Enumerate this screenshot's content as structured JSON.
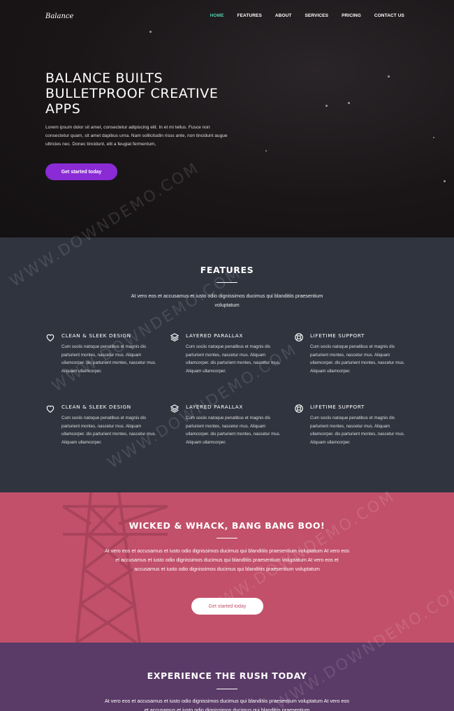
{
  "brand": "Balance",
  "nav": [
    {
      "label": "HOME",
      "active": true
    },
    {
      "label": "FEATURES"
    },
    {
      "label": "ABOUT"
    },
    {
      "label": "SERVICES"
    },
    {
      "label": "PRICING"
    },
    {
      "label": "CONTACT US"
    }
  ],
  "hero": {
    "title": "BALANCE BUILTS BULLETPROOF CREATIVE APPS",
    "text": "Lorem ipsum dolor sit amet, consectetur adipiscing elit. In et mi tellus. Fusce non consectetur quam, sit amet dapibus urna. Nam sollicitudin risus ante, non tincidunt augue ultricies nec. Donec tincidunt, elit a feugiat fermentum,",
    "button": "Get started today"
  },
  "features": {
    "title": "FEATURES",
    "subtitle": "At vero eos et accusamus et iusto odio dignissimos ducimus qui blanditiis praesentium voluptatum",
    "items": [
      {
        "icon": "heart-icon",
        "title": "CLEAN & SLEEK DESIGN",
        "text": "Cum sociis natoque penatibus et magnis dis parturient montes, nascetur mus. Aliquam ullamcorper. dis parturient montes, nascetur mus. Aliquam ullamcorper."
      },
      {
        "icon": "layers-icon",
        "title": "LAYERED PARALLAX",
        "text": "Cum sociis natoque penatibus et magnis dis parturient montes, nascetur mus. Aliquam ullamcorper. dis parturient montes, nascetur mus. Aliquam ullamcorper."
      },
      {
        "icon": "lifebuoy-icon",
        "title": "LIFETIME SUPPORT",
        "text": "Cum sociis natoque penatibus et magnis dis parturient montes, nascetur mus. Aliquam ullamcorper. dis parturient montes, nascetur mus. Aliquam ullamcorper."
      },
      {
        "icon": "heart-icon",
        "title": "CLEAN & SLEEK DESIGN",
        "text": "Cum sociis natoque penatibus et magnis dis parturient montes, nascetur mus. Aliquam ullamcorper. dis parturient montes, nascetur mus. Aliquam ullamcorper."
      },
      {
        "icon": "layers-icon",
        "title": "LAYERED PARALLAX",
        "text": "Cum sociis natoque penatibus et magnis dis parturient montes, nascetur mus. Aliquam ullamcorper. dis parturient montes, nascetur mus. Aliquam ullamcorper."
      },
      {
        "icon": "lifebuoy-icon",
        "title": "LIFETIME SUPPORT",
        "text": "Cum sociis natoque penatibus et magnis dis parturient montes, nascetur mus. Aliquam ullamcorper. dis parturient montes, nascetur mus. Aliquam ullamcorper."
      }
    ]
  },
  "wicked": {
    "title": "WICKED & WHACK, BANG BANG BOO!",
    "text": "At vero eos et accusamus et iusto odio dignissimos ducimus qui blanditiis praesentium voluptatum At vero eos et accusamus et iusto odio dignissimos ducimus qui blanditiis praesentium voluptatum At vero eos et accusamus et iusto odio dignissimos ducimus qui blanditiis praesentium voluptatum",
    "button": "Get started today"
  },
  "experience": {
    "title": "EXPERIENCE THE RUSH TODAY",
    "text": "At vero eos et accusamus et iusto odio dignissimos ducimus qui blanditiis praesentium voluptatum At vero eos et accusamus et iusto odio dignissimos ducimus qui blanditiis praesentium"
  },
  "watermark": "WWW.DOWNDEMO.COM",
  "colors": {
    "accent": "#4fd1b0",
    "button_purple": "#8a2bd6",
    "features_bg": "#30343f",
    "wicked_bg": "#c2506a",
    "experience_bg": "#5a3a66"
  }
}
